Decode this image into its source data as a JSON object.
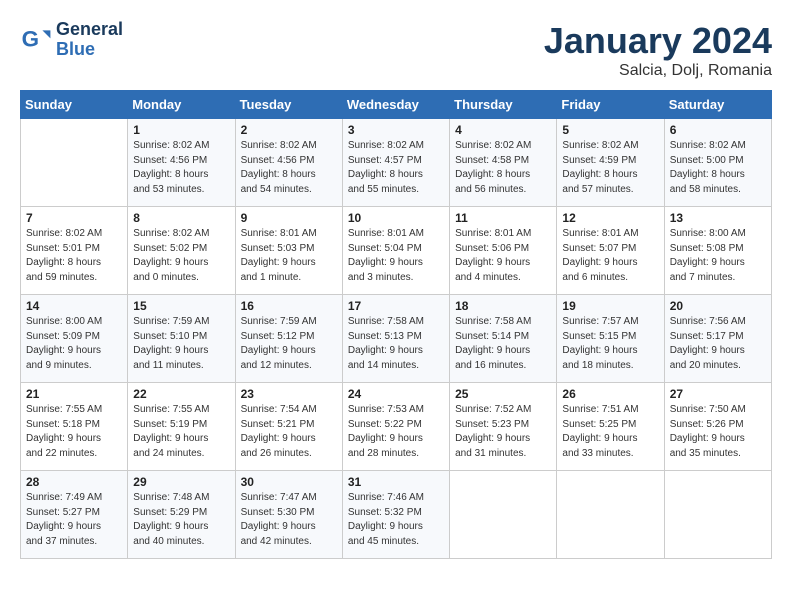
{
  "logo": {
    "name1": "General",
    "name2": "Blue"
  },
  "title": "January 2024",
  "location": "Salcia, Dolj, Romania",
  "days_header": [
    "Sunday",
    "Monday",
    "Tuesday",
    "Wednesday",
    "Thursday",
    "Friday",
    "Saturday"
  ],
  "weeks": [
    [
      {
        "day": "",
        "info": ""
      },
      {
        "day": "1",
        "info": "Sunrise: 8:02 AM\nSunset: 4:56 PM\nDaylight: 8 hours\nand 53 minutes."
      },
      {
        "day": "2",
        "info": "Sunrise: 8:02 AM\nSunset: 4:56 PM\nDaylight: 8 hours\nand 54 minutes."
      },
      {
        "day": "3",
        "info": "Sunrise: 8:02 AM\nSunset: 4:57 PM\nDaylight: 8 hours\nand 55 minutes."
      },
      {
        "day": "4",
        "info": "Sunrise: 8:02 AM\nSunset: 4:58 PM\nDaylight: 8 hours\nand 56 minutes."
      },
      {
        "day": "5",
        "info": "Sunrise: 8:02 AM\nSunset: 4:59 PM\nDaylight: 8 hours\nand 57 minutes."
      },
      {
        "day": "6",
        "info": "Sunrise: 8:02 AM\nSunset: 5:00 PM\nDaylight: 8 hours\nand 58 minutes."
      }
    ],
    [
      {
        "day": "7",
        "info": "Sunrise: 8:02 AM\nSunset: 5:01 PM\nDaylight: 8 hours\nand 59 minutes."
      },
      {
        "day": "8",
        "info": "Sunrise: 8:02 AM\nSunset: 5:02 PM\nDaylight: 9 hours\nand 0 minutes."
      },
      {
        "day": "9",
        "info": "Sunrise: 8:01 AM\nSunset: 5:03 PM\nDaylight: 9 hours\nand 1 minute."
      },
      {
        "day": "10",
        "info": "Sunrise: 8:01 AM\nSunset: 5:04 PM\nDaylight: 9 hours\nand 3 minutes."
      },
      {
        "day": "11",
        "info": "Sunrise: 8:01 AM\nSunset: 5:06 PM\nDaylight: 9 hours\nand 4 minutes."
      },
      {
        "day": "12",
        "info": "Sunrise: 8:01 AM\nSunset: 5:07 PM\nDaylight: 9 hours\nand 6 minutes."
      },
      {
        "day": "13",
        "info": "Sunrise: 8:00 AM\nSunset: 5:08 PM\nDaylight: 9 hours\nand 7 minutes."
      }
    ],
    [
      {
        "day": "14",
        "info": "Sunrise: 8:00 AM\nSunset: 5:09 PM\nDaylight: 9 hours\nand 9 minutes."
      },
      {
        "day": "15",
        "info": "Sunrise: 7:59 AM\nSunset: 5:10 PM\nDaylight: 9 hours\nand 11 minutes."
      },
      {
        "day": "16",
        "info": "Sunrise: 7:59 AM\nSunset: 5:12 PM\nDaylight: 9 hours\nand 12 minutes."
      },
      {
        "day": "17",
        "info": "Sunrise: 7:58 AM\nSunset: 5:13 PM\nDaylight: 9 hours\nand 14 minutes."
      },
      {
        "day": "18",
        "info": "Sunrise: 7:58 AM\nSunset: 5:14 PM\nDaylight: 9 hours\nand 16 minutes."
      },
      {
        "day": "19",
        "info": "Sunrise: 7:57 AM\nSunset: 5:15 PM\nDaylight: 9 hours\nand 18 minutes."
      },
      {
        "day": "20",
        "info": "Sunrise: 7:56 AM\nSunset: 5:17 PM\nDaylight: 9 hours\nand 20 minutes."
      }
    ],
    [
      {
        "day": "21",
        "info": "Sunrise: 7:55 AM\nSunset: 5:18 PM\nDaylight: 9 hours\nand 22 minutes."
      },
      {
        "day": "22",
        "info": "Sunrise: 7:55 AM\nSunset: 5:19 PM\nDaylight: 9 hours\nand 24 minutes."
      },
      {
        "day": "23",
        "info": "Sunrise: 7:54 AM\nSunset: 5:21 PM\nDaylight: 9 hours\nand 26 minutes."
      },
      {
        "day": "24",
        "info": "Sunrise: 7:53 AM\nSunset: 5:22 PM\nDaylight: 9 hours\nand 28 minutes."
      },
      {
        "day": "25",
        "info": "Sunrise: 7:52 AM\nSunset: 5:23 PM\nDaylight: 9 hours\nand 31 minutes."
      },
      {
        "day": "26",
        "info": "Sunrise: 7:51 AM\nSunset: 5:25 PM\nDaylight: 9 hours\nand 33 minutes."
      },
      {
        "day": "27",
        "info": "Sunrise: 7:50 AM\nSunset: 5:26 PM\nDaylight: 9 hours\nand 35 minutes."
      }
    ],
    [
      {
        "day": "28",
        "info": "Sunrise: 7:49 AM\nSunset: 5:27 PM\nDaylight: 9 hours\nand 37 minutes."
      },
      {
        "day": "29",
        "info": "Sunrise: 7:48 AM\nSunset: 5:29 PM\nDaylight: 9 hours\nand 40 minutes."
      },
      {
        "day": "30",
        "info": "Sunrise: 7:47 AM\nSunset: 5:30 PM\nDaylight: 9 hours\nand 42 minutes."
      },
      {
        "day": "31",
        "info": "Sunrise: 7:46 AM\nSunset: 5:32 PM\nDaylight: 9 hours\nand 45 minutes."
      },
      {
        "day": "",
        "info": ""
      },
      {
        "day": "",
        "info": ""
      },
      {
        "day": "",
        "info": ""
      }
    ]
  ]
}
